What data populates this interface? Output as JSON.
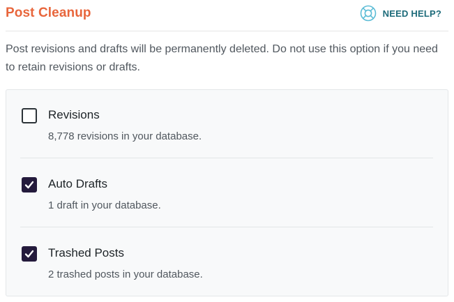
{
  "header": {
    "title": "Post Cleanup",
    "help_label": "NEED HELP?",
    "help_icon": "lifebuoy-icon",
    "title_color": "#e8663c",
    "help_color": "#1d6b7a"
  },
  "description": "Post revisions and drafts will be permanently deleted. Do not use this option if you need to retain revisions or drafts.",
  "options": [
    {
      "label": "Revisions",
      "description": "8,778 revisions in your database.",
      "checked": false
    },
    {
      "label": "Auto Drafts",
      "description": "1 draft in your database.",
      "checked": true
    },
    {
      "label": "Trashed Posts",
      "description": "2 trashed posts in your database.",
      "checked": true
    }
  ],
  "colors": {
    "checkbox_checked": "#241a3c",
    "panel_background": "#f8f9fa"
  }
}
